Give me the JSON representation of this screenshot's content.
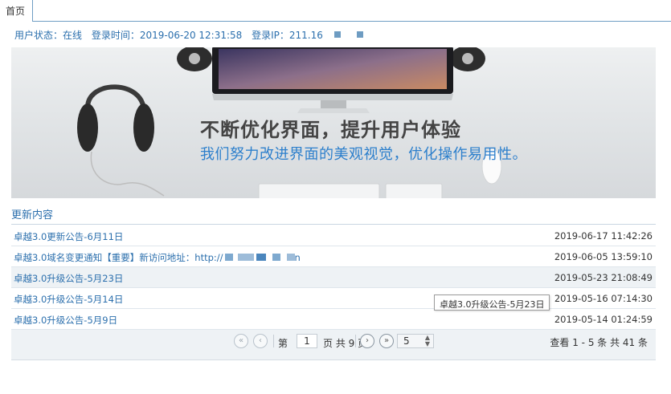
{
  "tabs": [
    {
      "label": "首页"
    }
  ],
  "status": {
    "user_state": "用户状态：在线",
    "login_time": "登录时间：2019-06-20 12:31:58",
    "login_ip": "登录IP：211.16"
  },
  "banner": {
    "headline": "不断优化界面，提升用户体验",
    "subline": "我们努力改进界面的美观视觉，优化操作易用性。"
  },
  "updates": {
    "title": "更新内容",
    "rows": [
      {
        "title": "卓越3.0更新公告-6月11日",
        "date": "2019-06-17 11:42:26"
      },
      {
        "title": "卓越3.0域名变更通知【重要】新访问地址：http://",
        "title_tail": "n",
        "date": "2019-06-05 13:59:10"
      },
      {
        "title": "卓越3.0升级公告-5月23日",
        "date": "2019-05-23 21:08:49"
      },
      {
        "title": "卓越3.0升级公告-5月14日",
        "date": "2019-05-16 07:14:30"
      },
      {
        "title": "卓越3.0升级公告-5月9日",
        "date": "2019-05-14 01:24:59"
      }
    ]
  },
  "pager": {
    "first": "«",
    "prev": "‹",
    "page_prefix": "第",
    "page_value": "1",
    "page_suffix": "页 共 9 页",
    "next": "›",
    "last": "»",
    "page_size": "5",
    "info": "查看 1 - 5 条 共 41 条"
  },
  "tooltip": "卓越3.0升级公告-5月23日"
}
